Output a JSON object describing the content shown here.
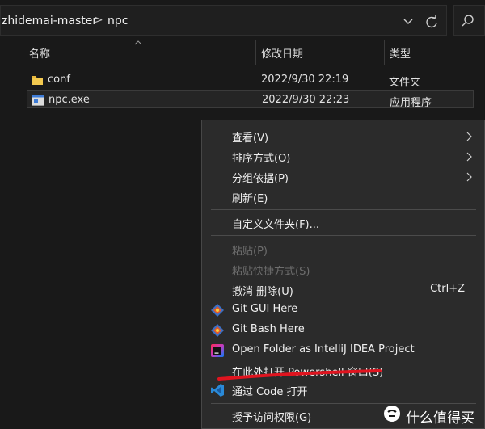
{
  "address": {
    "segments": [
      "zhidemai-master",
      "npc"
    ],
    "separator": ">",
    "dropdown_icon": "chevron-down-icon",
    "refresh_icon": "refresh-icon",
    "search_icon": "search-icon"
  },
  "columns": [
    "名称",
    "修改日期",
    "类型"
  ],
  "files": [
    {
      "name": "conf",
      "modified": "2022/9/30 22:19",
      "type": "文件夹",
      "icon": "folder-icon",
      "selected": false
    },
    {
      "name": "npc.exe",
      "modified": "2022/9/30 22:23",
      "type": "应用程序",
      "icon": "exe-icon",
      "selected": true
    }
  ],
  "context_menu": {
    "items": [
      {
        "label": "查看(V)",
        "submenu": true
      },
      {
        "label": "排序方式(O)",
        "submenu": true
      },
      {
        "label": "分组依据(P)",
        "submenu": true
      },
      {
        "label": "刷新(E)"
      },
      {
        "label": "自定义文件夹(F)..."
      },
      {
        "label": "粘贴(P)",
        "disabled": true
      },
      {
        "label": "粘贴快捷方式(S)",
        "disabled": true
      },
      {
        "label": "撤消 删除(U)",
        "shortcut": "Ctrl+Z"
      },
      {
        "label": "Git GUI Here",
        "icon": "git-gui-icon"
      },
      {
        "label": "Git Bash Here",
        "icon": "git-bash-icon"
      },
      {
        "label": "Open Folder as IntelliJ IDEA Project",
        "icon": "intellij-icon"
      },
      {
        "label": "在此处打开 Powershell 窗口(S)",
        "highlighted": true
      },
      {
        "label": "通过 Code 打开",
        "icon": "vscode-icon"
      },
      {
        "label": "授予访问权限(G)"
      }
    ]
  },
  "watermark": {
    "text": "什么值得买",
    "logo": "smzdm-logo-icon"
  },
  "colors": {
    "background": "#191919",
    "menu_bg": "#2b2b2b",
    "annotation_red": "#e0141f"
  }
}
